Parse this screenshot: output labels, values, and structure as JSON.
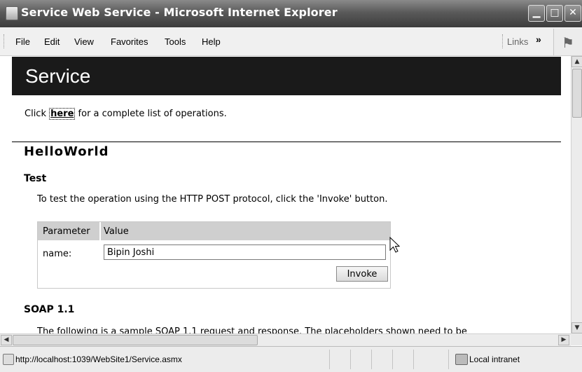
{
  "window": {
    "title": "Service Web Service - Microsoft Internet Explorer",
    "buttons": {
      "minimize": "▁",
      "maximize": "□",
      "close": "✕"
    }
  },
  "menu": {
    "items": [
      "File",
      "Edit",
      "View",
      "Favorites",
      "Tools",
      "Help"
    ],
    "links_label": "Links",
    "chevron": "»"
  },
  "page": {
    "hero_title": "Service",
    "intro_prefix": "Click ",
    "intro_link": "here",
    "intro_suffix": " for a complete list of operations.",
    "operation_title": "HelloWorld",
    "test_heading": "Test",
    "test_description": "To test the operation using the HTTP POST protocol, click the 'Invoke' button.",
    "form": {
      "param_header": "Parameter",
      "value_header": "Value",
      "name_label": "name:",
      "name_value": "Bipin Joshi",
      "invoke_label": "Invoke"
    },
    "soap_heading": "SOAP 1.1",
    "soap_description": "The following is a sample SOAP 1.1 request and response. The placeholders shown need to be"
  },
  "status": {
    "url": "http://localhost:1039/WebSite1/Service.asmx",
    "zone": "Local intranet"
  },
  "colors": {
    "hero_background": "#1a1a1a",
    "form_header": "#cfcfcf"
  }
}
